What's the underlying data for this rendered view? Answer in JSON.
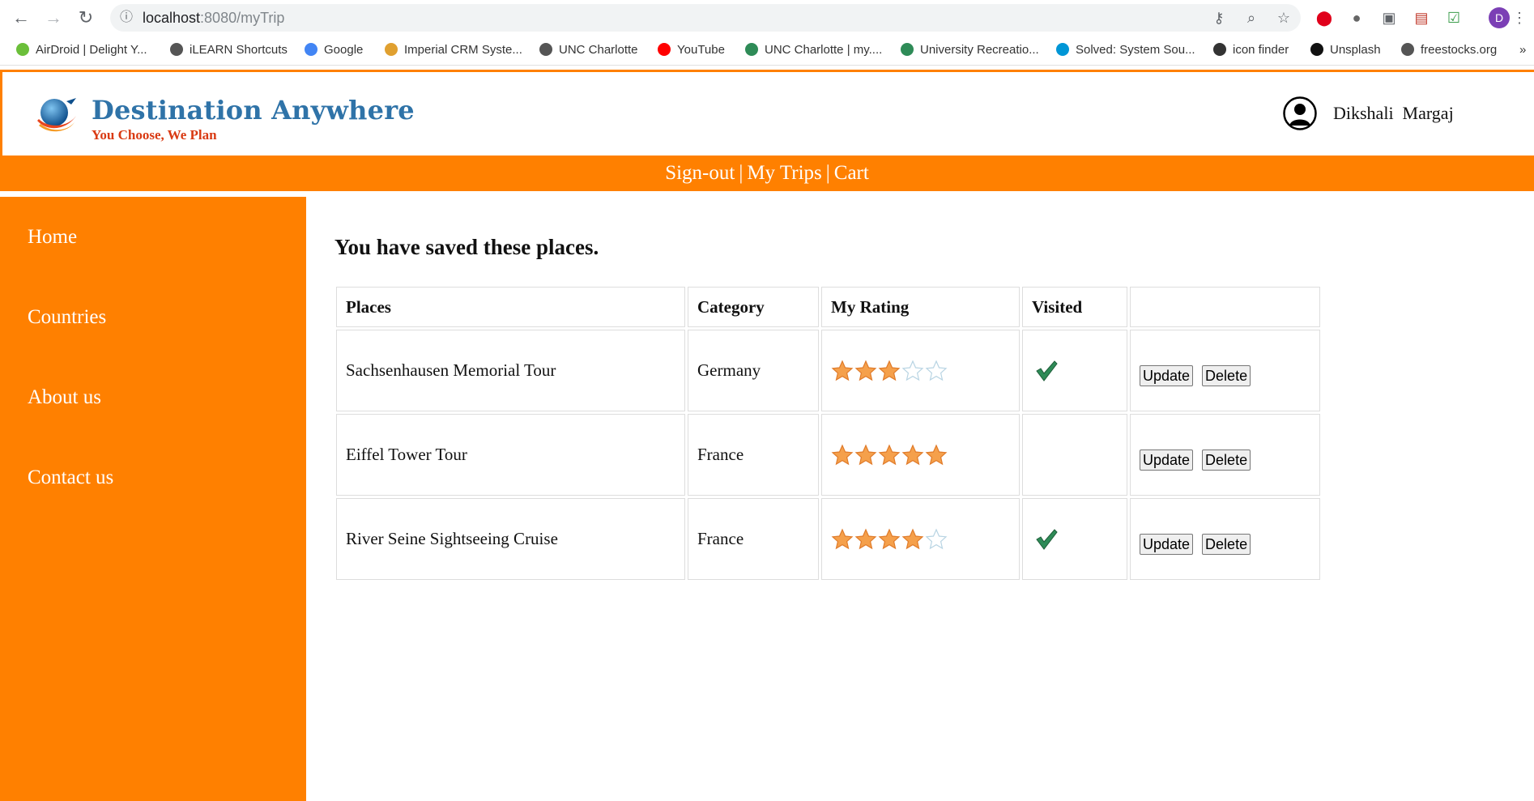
{
  "browser": {
    "url_host": "localhost",
    "url_path": ":8080/myTrip",
    "profile_initial": "D",
    "bookmarks": [
      {
        "label": "AirDroid | Delight Y...",
        "color": "#6bbf3a"
      },
      {
        "label": "iLEARN Shortcuts",
        "color": "#555555"
      },
      {
        "label": "Google",
        "color": "#4285f4"
      },
      {
        "label": "Imperial CRM Syste...",
        "color": "#e0a030"
      },
      {
        "label": "UNC Charlotte",
        "color": "#555555"
      },
      {
        "label": "YouTube",
        "color": "#ff0000"
      },
      {
        "label": "UNC Charlotte | my....",
        "color": "#2e8b57"
      },
      {
        "label": "University Recreatio...",
        "color": "#2e8b57"
      },
      {
        "label": "Solved: System Sou...",
        "color": "#0096d6"
      },
      {
        "label": "icon finder",
        "color": "#333333"
      },
      {
        "label": "Unsplash",
        "color": "#111111"
      },
      {
        "label": "freestocks.org",
        "color": "#555555"
      }
    ],
    "overflow": "»"
  },
  "header": {
    "brand_title": "Destination Anywhere",
    "brand_tagline": "You Choose, We Plan",
    "user_name": "Dikshali  Margaj"
  },
  "top_nav": {
    "signout": "Sign-out",
    "my_trips": "My Trips",
    "cart": "Cart",
    "separator": "|"
  },
  "sidebar": {
    "items": [
      "Home",
      "Countries",
      "About us",
      "Contact us"
    ]
  },
  "main": {
    "heading": "You have saved these places.",
    "columns": [
      "Places",
      "Category",
      "My Rating",
      "Visited",
      ""
    ],
    "rows": [
      {
        "place": "Sachsenhausen Memorial Tour",
        "category": "Germany",
        "rating": 3,
        "visited": true
      },
      {
        "place": "Eiffel Tower Tour",
        "category": "France",
        "rating": 5,
        "visited": false
      },
      {
        "place": "River Seine Sightseeing Cruise",
        "category": "France",
        "rating": 4,
        "visited": true
      }
    ],
    "update_label": "Update",
    "delete_label": "Delete",
    "max_rating": 5
  },
  "colors": {
    "brand_orange": "#ff8000",
    "brand_blue": "#2f73a8",
    "tagline_red": "#d93a13",
    "star_filled": "#f5a04b",
    "check_green": "#2e8b57"
  }
}
